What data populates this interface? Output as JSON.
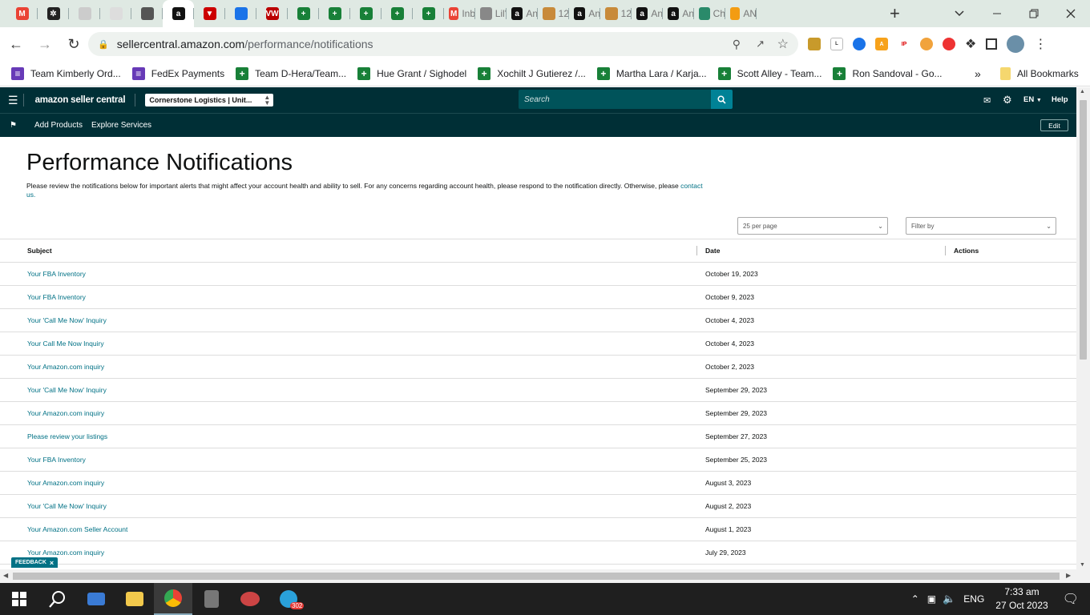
{
  "browser": {
    "tabs": [
      {
        "icon": "gmail-icon",
        "label": ""
      },
      {
        "icon": "chatgpt-icon",
        "label": ""
      },
      {
        "icon": "ahrefs-icon",
        "label": ""
      },
      {
        "icon": "app-icon",
        "label": ""
      },
      {
        "icon": "globe-icon",
        "label": ""
      },
      {
        "icon": "amazon-icon",
        "label": "",
        "active": true
      },
      {
        "icon": "triangle-icon",
        "label": ""
      },
      {
        "icon": "helium-icon",
        "label": ""
      },
      {
        "icon": "vw-icon",
        "label": ""
      },
      {
        "icon": "sheets-icon",
        "label": ""
      },
      {
        "icon": "sheets-icon",
        "label": ""
      },
      {
        "icon": "sheets-icon",
        "label": ""
      },
      {
        "icon": "sheets-icon",
        "label": ""
      },
      {
        "icon": "sheets-icon",
        "label": ""
      },
      {
        "icon": "gmail-icon",
        "label": "Inb"
      },
      {
        "icon": "clock-icon",
        "label": "Lil'"
      },
      {
        "icon": "amazon-icon",
        "label": "An"
      },
      {
        "icon": "coin-icon",
        "label": "12"
      },
      {
        "icon": "amazon-icon",
        "label": "An"
      },
      {
        "icon": "coin-icon",
        "label": "12"
      },
      {
        "icon": "amazon-icon",
        "label": "An"
      },
      {
        "icon": "amazon-icon",
        "label": "An"
      },
      {
        "icon": "chart-icon",
        "label": "Ch"
      },
      {
        "icon": "pencil-icon",
        "label": "AN"
      }
    ],
    "url_host": "sellercentral.amazon.com",
    "url_path": "/performance/notifications",
    "bookmarks": [
      {
        "icon": "forms-icon",
        "label": "Team Kimberly Ord..."
      },
      {
        "icon": "forms-icon",
        "label": "FedEx Payments"
      },
      {
        "icon": "sheets-icon",
        "label": "Team D-Hera/Team..."
      },
      {
        "icon": "sheets-icon",
        "label": "Hue Grant / Sighodel"
      },
      {
        "icon": "sheets-icon",
        "label": "Xochilt J Gutierez /..."
      },
      {
        "icon": "sheets-icon",
        "label": "Martha Lara / Karja..."
      },
      {
        "icon": "sheets-icon",
        "label": "Scott Alley - Team..."
      },
      {
        "icon": "sheets-icon",
        "label": "Ron Sandoval - Go..."
      }
    ],
    "all_bookmarks": "All Bookmarks"
  },
  "seller": {
    "logo": "amazon seller central",
    "account": "Cornerstone Logistics | Unit...",
    "search_placeholder": "Search",
    "lang": "EN",
    "help": "Help",
    "subnav": [
      "Add Products",
      "Explore Services"
    ],
    "edit": "Edit"
  },
  "page": {
    "title": "Performance Notifications",
    "description": "Please review the notifications below for important alerts that might affect your account health and ability to sell. For any concerns regarding account health, please respond to the notification directly. Otherwise, please",
    "contact_link": "contact us.",
    "per_page": "25 per page",
    "filter_placeholder": "Filter by",
    "columns": {
      "subject": "Subject",
      "date": "Date",
      "actions": "Actions"
    },
    "rows": [
      {
        "subject": "Your FBA Inventory",
        "date": "October 19, 2023"
      },
      {
        "subject": "Your FBA Inventory",
        "date": "October 9, 2023"
      },
      {
        "subject": "Your 'Call Me Now' Inquiry",
        "date": "October 4, 2023"
      },
      {
        "subject": "Your Call Me Now Inquiry",
        "date": "October 4, 2023"
      },
      {
        "subject": "Your Amazon.com inquiry",
        "date": "October 2, 2023"
      },
      {
        "subject": "Your 'Call Me Now' Inquiry",
        "date": "September 29, 2023"
      },
      {
        "subject": "Your Amazon.com inquiry",
        "date": "September 29, 2023"
      },
      {
        "subject": "Please review your listings",
        "date": "September 27, 2023"
      },
      {
        "subject": "Your FBA Inventory",
        "date": "September 25, 2023"
      },
      {
        "subject": "Your Amazon.com inquiry",
        "date": "August 3, 2023"
      },
      {
        "subject": "Your 'Call Me Now' Inquiry",
        "date": "August 2, 2023"
      },
      {
        "subject": "Your Amazon.com Seller Account",
        "date": "August 1, 2023"
      },
      {
        "subject": "Your Amazon.com inquiry",
        "date": "July 29, 2023"
      }
    ],
    "feedback": "FEEDBACK"
  },
  "taskbar": {
    "lang": "ENG",
    "time": "7:33 am",
    "date": "27 Oct 2023",
    "telegram_badge": "302"
  },
  "colors": {
    "nav": "#002f36",
    "link": "#007185",
    "tabbar": "#dfe9e3"
  }
}
